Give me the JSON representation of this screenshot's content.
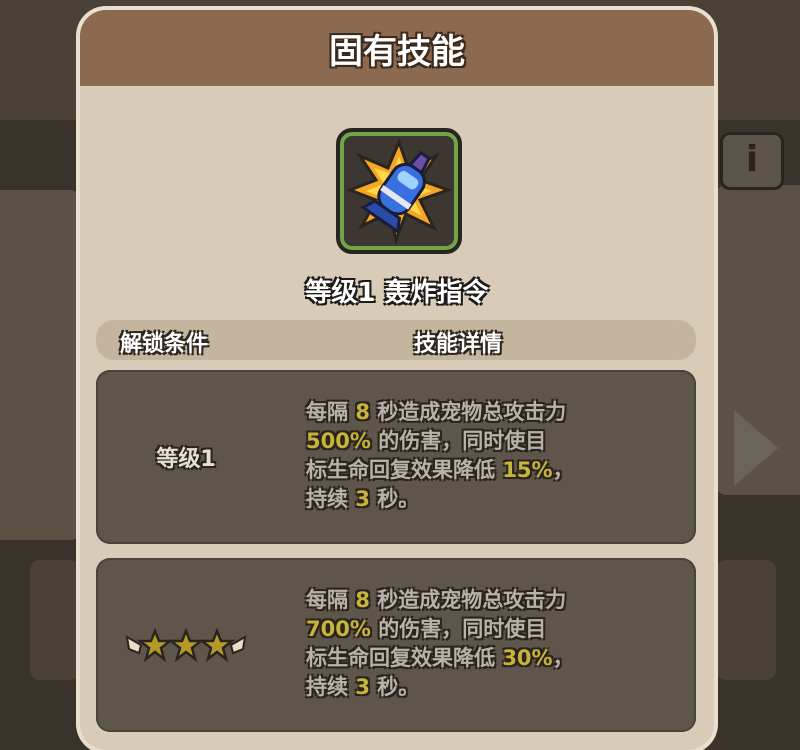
{
  "modal": {
    "title": "固有技能"
  },
  "skill": {
    "name": "等级1 轰炸指令",
    "icon": "rocket-explosion-icon"
  },
  "table": {
    "headers": {
      "condition": "解锁条件",
      "detail": "技能详情"
    },
    "rows": [
      {
        "condition": "等级1",
        "detail": {
          "seg1": "每隔",
          "interval": "8",
          "seg2": "秒造成宠物总攻击力",
          "damage": "500%",
          "seg3": "的伤害，同时使目",
          "seg4": "标生命回复效果降低",
          "reduction": "15%",
          "seg5": "，",
          "seg6": "持续",
          "duration": "3",
          "seg7": "秒。"
        }
      },
      {
        "condition_icon": "three-stars-icon",
        "detail": {
          "seg1": "每隔",
          "interval": "8",
          "seg2": "秒造成宠物总攻击力",
          "damage": "700%",
          "seg3": "的伤害，同时使目",
          "seg4": "标生命回复效果降低",
          "reduction": "30%",
          "seg5": "，",
          "seg6": "持续",
          "duration": "3",
          "seg7": "秒。"
        }
      }
    ]
  },
  "background": {
    "info_label": "i"
  },
  "colors": {
    "header_brown": "#8b6a50",
    "panel_beige": "#d8ccb8",
    "highlight_gold": "#c9b43a",
    "row_dark": "#5e554b"
  }
}
